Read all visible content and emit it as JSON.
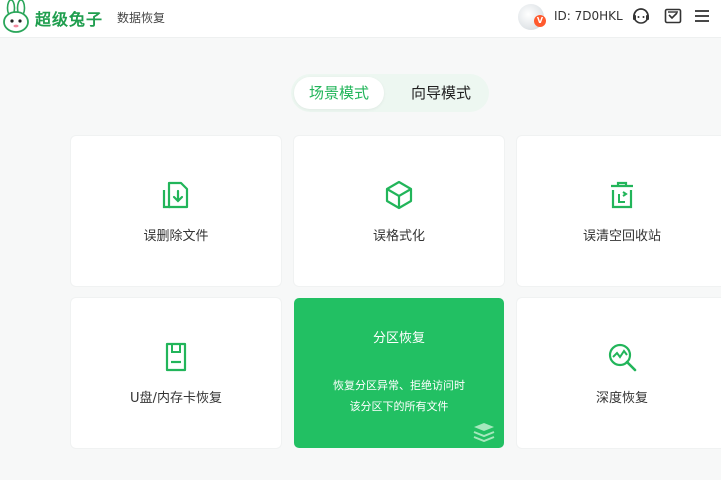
{
  "header": {
    "brand": "超级兔子",
    "subtitle": "数据恢复",
    "vip_badge": "V",
    "user_id": "ID: 7D0HKL",
    "icons": [
      "rabbit-logo-icon",
      "avatar-icon",
      "support-icon",
      "message-icon",
      "menu-icon"
    ]
  },
  "modes": {
    "tabs": [
      {
        "label": "场景模式",
        "active": true
      },
      {
        "label": "向导模式",
        "active": false
      }
    ]
  },
  "cards": [
    {
      "label": "误删除文件",
      "icon": "file-restore-icon"
    },
    {
      "label": "误格式化",
      "icon": "cube-icon"
    },
    {
      "label": "误清空回收站",
      "icon": "recycle-bin-icon"
    },
    {
      "label": "U盘/内存卡恢复",
      "icon": "sd-card-icon"
    },
    {
      "label": "分区恢复",
      "active": true,
      "icon": "layers-icon",
      "description_lines": [
        "恢复分区异常、拒绝访问时",
        "该分区下的所有文件"
      ]
    },
    {
      "label": "深度恢复",
      "icon": "deep-search-icon"
    }
  ],
  "colors": {
    "accent": "#22c063",
    "accent_text": "#22b55a",
    "brand": "#1f9e4e",
    "badge": "#ff5a2e"
  }
}
